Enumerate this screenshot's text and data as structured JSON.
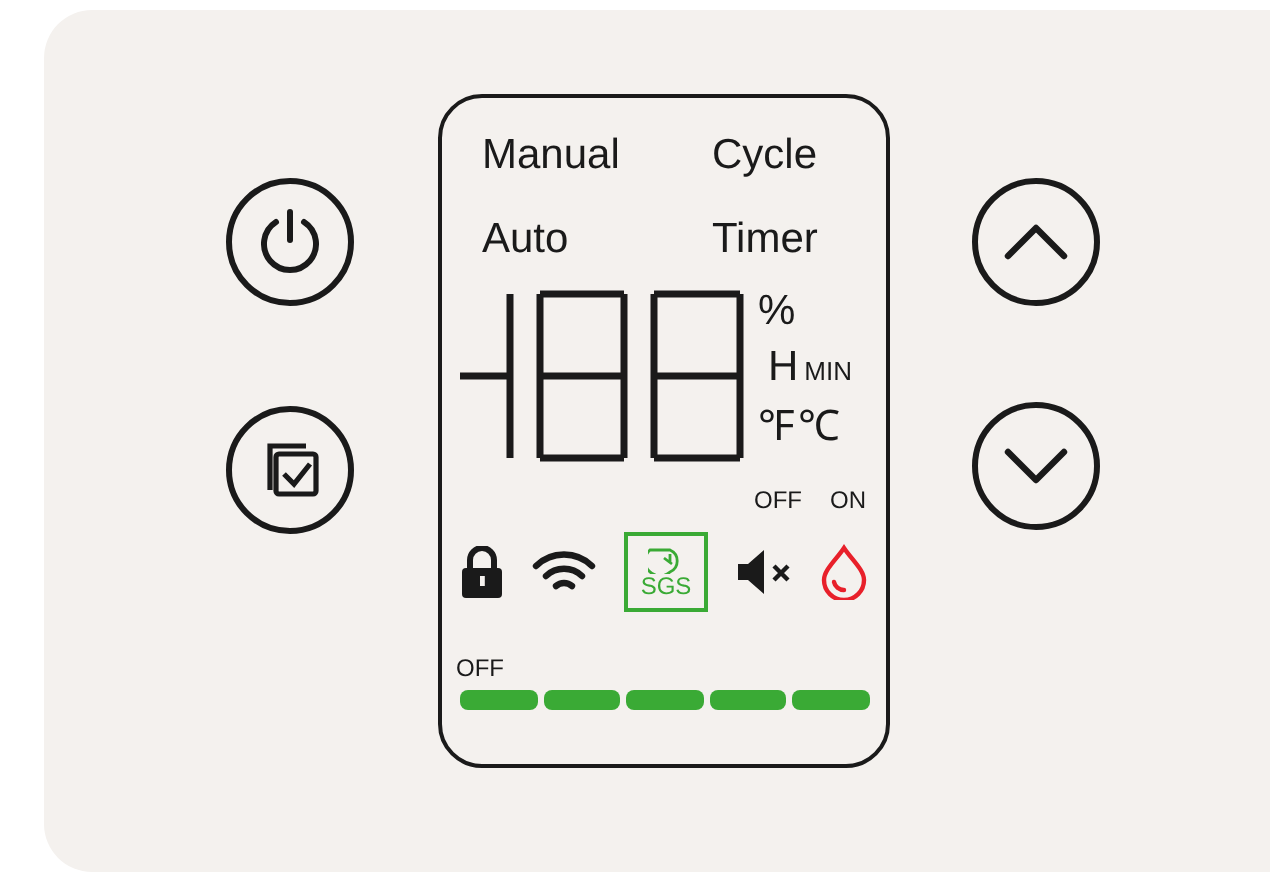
{
  "left_buttons": [
    {
      "kind": "power"
    },
    {
      "kind": "select"
    }
  ],
  "right_buttons": [
    {
      "kind": "up"
    },
    {
      "kind": "down"
    }
  ],
  "display": {
    "modes": [
      "Manual",
      "Cycle",
      "Auto",
      "Timer"
    ],
    "units": {
      "percent": "%",
      "hour": "H",
      "minute": "MIN",
      "fahrenheit": "℉",
      "celsius": "℃"
    },
    "status_labels": [
      "OFF",
      "ON"
    ],
    "indicators": [
      {
        "kind": "lock"
      },
      {
        "kind": "wifi"
      },
      {
        "kind": "sgs",
        "label": "SGS"
      },
      {
        "kind": "mute"
      },
      {
        "kind": "drop"
      }
    ],
    "fan": {
      "label": "OFF",
      "segments": [
        {
          "on": true
        },
        {
          "on": true
        },
        {
          "on": true
        },
        {
          "on": true
        },
        {
          "on": true
        }
      ]
    }
  }
}
